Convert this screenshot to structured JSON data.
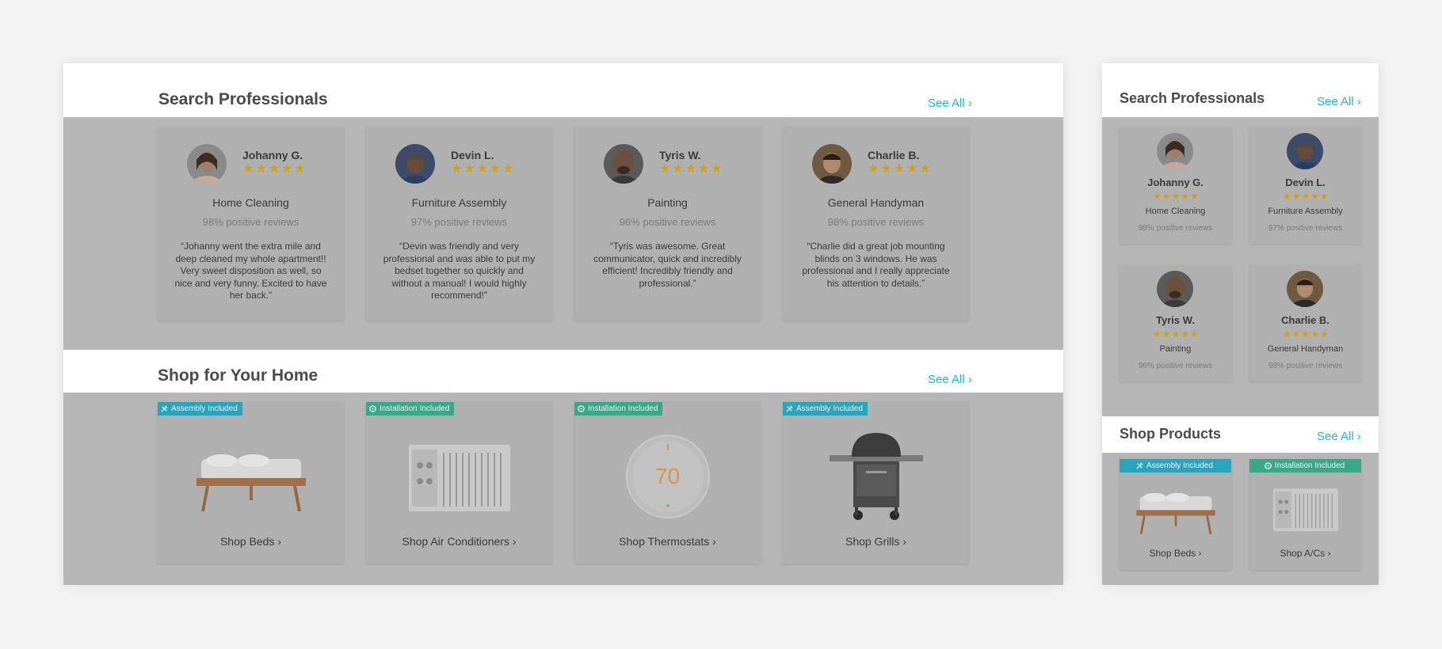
{
  "colors": {
    "accent": "#19b8d6",
    "star": "#d4a00e",
    "assembly_badge": "#2aa3bd",
    "install_badge": "#3aa788",
    "overlay": "#b6b6b6"
  },
  "desktop": {
    "search_title": "Search Professionals",
    "search_see_all": "See All ›",
    "shop_title": "Shop for Your Home",
    "shop_see_all": "See All ›",
    "pros": [
      {
        "name": "Johanny G.",
        "service": "Home Cleaning",
        "reviews": "98% positive reviews",
        "rating": 5,
        "quote": "“Johanny went the extra mile and deep cleaned my whole apartment!! Very sweet disposition as well, so nice and very funny. Excited to have her back.”"
      },
      {
        "name": "Devin L.",
        "service": "Furniture Assembly",
        "reviews": "97% positive reviews",
        "rating": 5,
        "quote": "“Devin was friendly and very professional and was able to put my bedset together so quickly and without a manual! I would highly recommend!”"
      },
      {
        "name": "Tyris W.",
        "service": "Painting",
        "reviews": "96% positive reviews",
        "rating": 5,
        "quote": "“Tyris was awesome. Great communicator, quick and incredibly efficient! Incredibly friendly and professional.”"
      },
      {
        "name": "Charlie B.",
        "service": "General Handyman",
        "reviews": "98% positive reviews",
        "rating": 5,
        "quote": "“Charlie did a great job mounting blinds on 3 windows. He was professional and I really appreciate his attention to details.”"
      }
    ],
    "products": [
      {
        "badge": "Assembly Included",
        "badge_type": "assembly",
        "label": "Shop Beds ›",
        "icon": "bed-image"
      },
      {
        "badge": "Installation Included",
        "badge_type": "install",
        "label": "Shop Air Conditioners ›",
        "icon": "air-conditioner-image"
      },
      {
        "badge": "Installation Included",
        "badge_type": "install",
        "label": "Shop Thermostats ›",
        "icon": "thermostat-image",
        "reading": "70"
      },
      {
        "badge": "Assembly Included",
        "badge_type": "assembly",
        "label": "Shop Grills ›",
        "icon": "grill-image"
      }
    ]
  },
  "mobile": {
    "search_title": "Search Professionals",
    "search_see_all": "See All ›",
    "shop_title": "Shop Products",
    "shop_see_all": "See All ›",
    "pros": [
      {
        "name": "Johanny G.",
        "service": "Home Cleaning",
        "reviews": "98% positive reviews"
      },
      {
        "name": "Devin L.",
        "service": "Furniture Assembly",
        "reviews": "97% positive reviews"
      },
      {
        "name": "Tyris W.",
        "service": "Painting",
        "reviews": "96% positive reviews"
      },
      {
        "name": "Charlie B.",
        "service": "General Handyman",
        "reviews": "98% positive reviews"
      }
    ],
    "products": [
      {
        "badge": "Assembly Included",
        "badge_type": "assembly",
        "label": "Shop Beds ›"
      },
      {
        "badge": "Installation Included",
        "badge_type": "install",
        "label": "Shop A/Cs ›"
      }
    ]
  }
}
